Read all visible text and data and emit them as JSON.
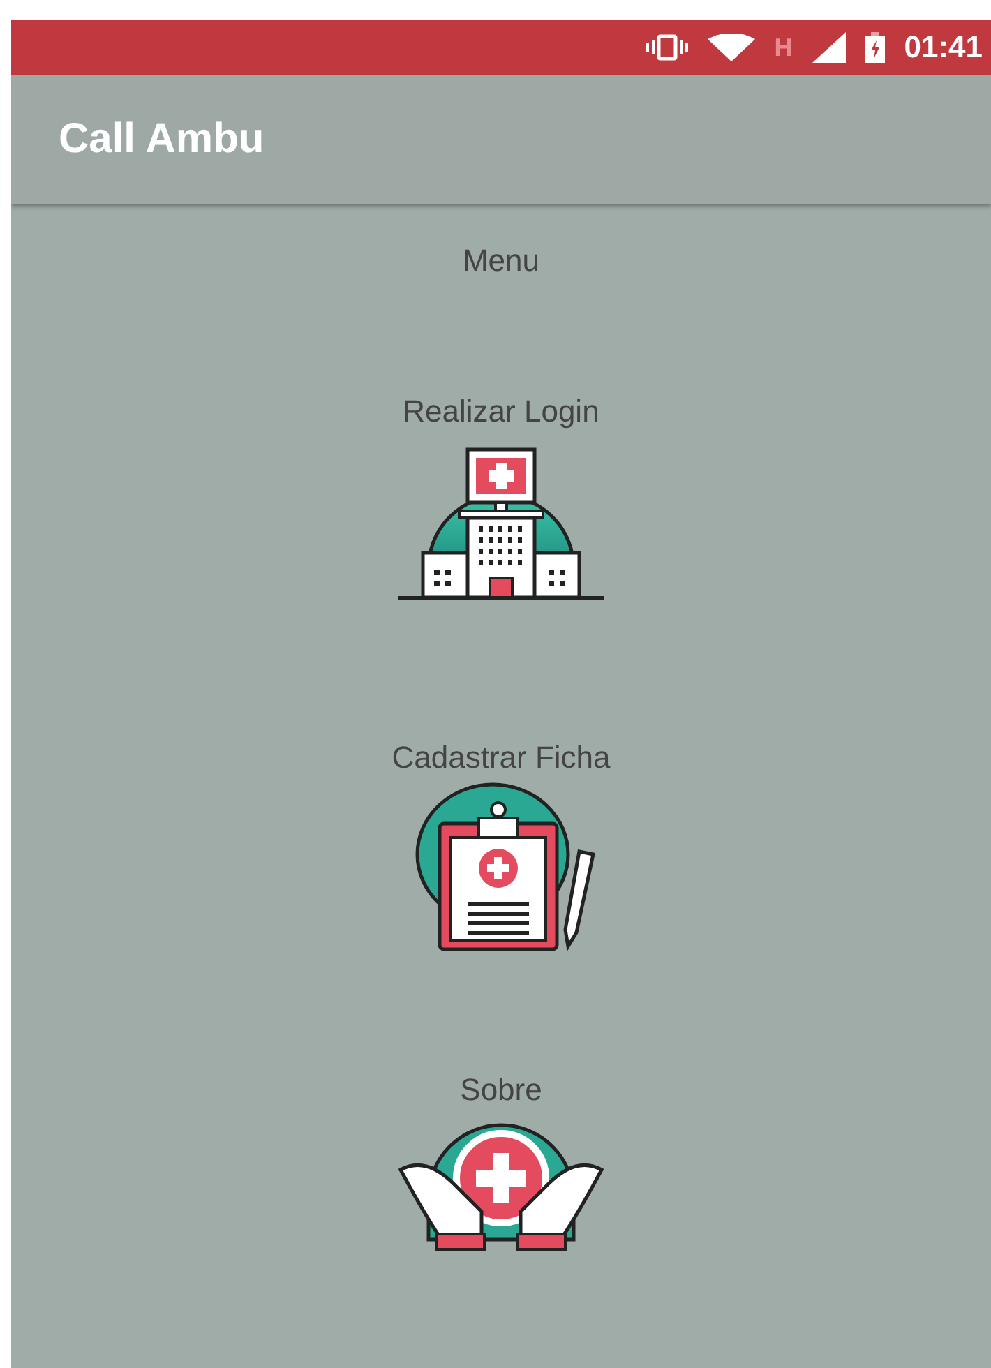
{
  "status_bar": {
    "network_type": "H",
    "time": "01:41"
  },
  "app_bar": {
    "title": "Call Ambu"
  },
  "menu": {
    "heading": "Menu",
    "items": [
      {
        "label": "Realizar Login",
        "kind": "hospital"
      },
      {
        "label": "Cadastrar Ficha",
        "kind": "clipboard"
      },
      {
        "label": "Sobre",
        "kind": "hands"
      }
    ]
  }
}
